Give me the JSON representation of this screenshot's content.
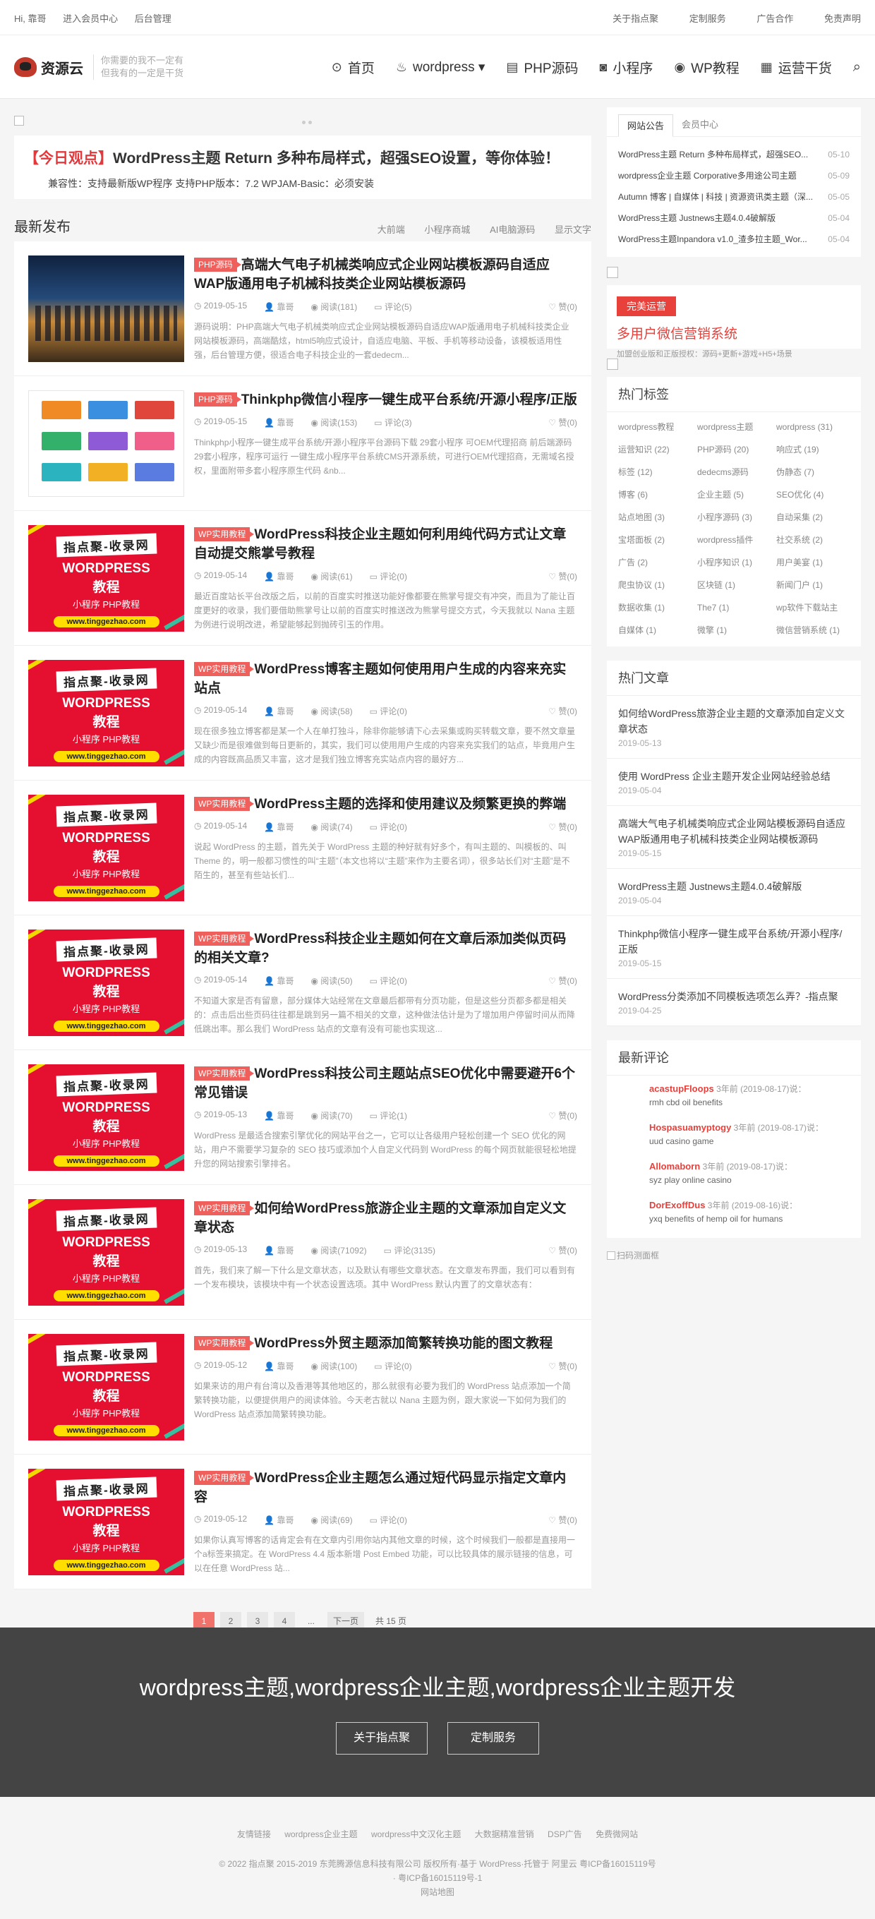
{
  "topbar": {
    "greeting": "Hi, 靠哥",
    "member": "进入会员中心",
    "admin": "后台管理",
    "links": [
      "关于指点聚",
      "定制服务",
      "广告合作",
      "免责声明"
    ]
  },
  "header": {
    "logo_text": "资源云",
    "slogan_1": "你需要的我不一定有",
    "slogan_2": "但我有的一定是干货",
    "nav": [
      {
        "icon": "home-icon",
        "glyph": "⊙",
        "label": "首页"
      },
      {
        "icon": "wordpress-icon",
        "glyph": "♨",
        "label": "wordpress ▾"
      },
      {
        "icon": "php-icon",
        "glyph": "▤",
        "label": "PHP源码"
      },
      {
        "icon": "miniapp-icon",
        "glyph": "◙",
        "label": "小程序"
      },
      {
        "icon": "wp-tutorial-icon",
        "glyph": "◉",
        "label": "WP教程"
      },
      {
        "icon": "operations-icon",
        "glyph": "▦",
        "label": "运营干货"
      }
    ]
  },
  "notice": {
    "tag": "【今日观点】",
    "title": "WordPress主题 Return 多种布局样式，超强SEO设置，等你体验！",
    "sub": "兼容性：支持最新版WP程序 支持PHP版本：7.2 WPJAM-Basic：必须安装"
  },
  "section": {
    "title": "最新发布",
    "tabs": [
      "大前端",
      "小程序商城",
      "AI电脑源码",
      "显示文字"
    ]
  },
  "thumb_text": {
    "l1": "指点聚-收录网",
    "l2": "WORDPRESS",
    "l3": "教程",
    "l4": "小程序 PHP教程",
    "l5": "www.tinggezhao.com"
  },
  "posts": [
    {
      "thumb": "city",
      "cat": "PHP源码",
      "title": "高端大气电子机械类响应式企业网站模板源码自适应WAP版通用电子机械科技类企业网站模板源码",
      "date": "2019-05-15",
      "author": "靠哥",
      "views": "阅读(181)",
      "comments": "评论(5)",
      "likes": "赞(0)",
      "excerpt": "源码说明：PHP高端大气电子机械类响应式企业网站模板源码自适应WAP版通用电子机械科技类企业网站模板源码，高端酷炫，html5响应式设计，自适应电脑、平板、手机等移动设备，该模板适用性强，后台管理方便，很适合电子科技企业的一套dedecm..."
    },
    {
      "thumb": "app",
      "cat": "PHP源码",
      "title": "Thinkphp微信小程序一键生成平台系统/开源小程序/正版",
      "date": "2019-05-15",
      "author": "靠哥",
      "views": "阅读(153)",
      "comments": "评论(3)",
      "likes": "赞(0)",
      "excerpt": "Thinkphp小程序一键生成平台系统/开源小程序平台源码下载 29套小程序 可OEM代理招商 前后端源码29套小程序，程序可运行 一键生成小程序平台系统CMS开源系统，可进行OEM代理招商，无需域名授权，里面附带多套小程序原生代码 &nb..."
    },
    {
      "thumb": "red",
      "cat": "WP实用教程",
      "title": "WordPress科技企业主题如何利用纯代码方式让文章自动提交熊掌号教程",
      "date": "2019-05-14",
      "author": "靠哥",
      "views": "阅读(61)",
      "comments": "评论(0)",
      "likes": "赞(0)",
      "excerpt": "最近百度站长平台改版之后，以前的百度实时推送功能好像都要在熊掌号提交有冲突，而且为了能让百度更好的收录，我们要借助熊掌号让以前的百度实时推送改为熊掌号提交方式，今天我就以 Nana 主题为例进行说明改进，希望能够起到抛砖引玉的作用。"
    },
    {
      "thumb": "red",
      "cat": "WP实用教程",
      "title": "WordPress博客主题如何使用用户生成的内容来充实站点",
      "date": "2019-05-14",
      "author": "靠哥",
      "views": "阅读(58)",
      "comments": "评论(0)",
      "likes": "赞(0)",
      "excerpt": "现在很多独立博客都是某一个人在单打独斗，除非你能够请下心去采集或购买转载文章，要不然文章量又缺少而是很难做到每日更新的，其实，我们可以使用用户生成的内容来充实我们的站点，毕竟用户生成的内容既高品质又丰富，这才是我们独立博客充实站点内容的最好方..."
    },
    {
      "thumb": "red",
      "cat": "WP实用教程",
      "title": "WordPress主题的选择和使用建议及频繁更换的弊端",
      "date": "2019-05-14",
      "author": "靠哥",
      "views": "阅读(74)",
      "comments": "评论(0)",
      "likes": "赞(0)",
      "excerpt": "说起 WordPress 的主题，首先关于 WordPress 主题的种好就有好多个，有叫主题的、叫模板的、叫 Theme 的，明一般都习惯性的叫“主题”（本文也将以“主题”来作为主要名词），很多站长们对“主题”是不陌生的，甚至有些站长们..."
    },
    {
      "thumb": "red",
      "cat": "WP实用教程",
      "title": "WordPress科技企业主题如何在文章后添加类似页码的相关文章?",
      "date": "2019-05-14",
      "author": "靠哥",
      "views": "阅读(50)",
      "comments": "评论(0)",
      "likes": "赞(0)",
      "excerpt": "不知道大家是否有留意，部分媒体大站经常在文章最后都带有分页功能，但是这些分页都多都是相关的：点击后出些页码往往都是跳到另一篇不相关的文章，这种做法估计是为了增加用户停留时间从而降低跳出率。那么我们 WordPress 站点的文章有没有可能也实现这..."
    },
    {
      "thumb": "red",
      "cat": "WP实用教程",
      "title": "WordPress科技公司主题站点SEO优化中需要避开6个常见错误",
      "date": "2019-05-13",
      "author": "靠哥",
      "views": "阅读(70)",
      "comments": "评论(1)",
      "likes": "赞(0)",
      "excerpt": "WordPress 是最适合搜索引擎优化的网站平台之一，它可以让各级用户轻松创建一个 SEO 优化的网站，用户不需要学习复杂的 SEO 技巧或添加个人自定义代码到 WordPress 的每个网页就能很轻松地提升您的网站搜索引擎排名。"
    },
    {
      "thumb": "red",
      "cat": "WP实用教程",
      "title": "如何给WordPress旅游企业主题的文章添加自定义文章状态",
      "date": "2019-05-13",
      "author": "靠哥",
      "views": "阅读(71092)",
      "comments": "评论(3135)",
      "likes": "赞(0)",
      "excerpt": "首先，我们来了解一下什么是文章状态，以及默认有哪些文章状态。在文章发布界面，我们可以看到有一个发布模块，该模块中有一个状态设置选项。其中 WordPress 默认内置了的文章状态有："
    },
    {
      "thumb": "red",
      "cat": "WP实用教程",
      "title": "WordPress外贸主题添加简繁转换功能的图文教程",
      "date": "2019-05-12",
      "author": "靠哥",
      "views": "阅读(100)",
      "comments": "评论(0)",
      "likes": "赞(0)",
      "excerpt": "如果来访的用户有台湾以及香港等其他地区的，那么就很有必要为我们的 WordPress 站点添加一个简繁转换功能，以便提供用户的阅读体验。今天老古就以 Nana 主题为例，跟大家说一下如何为我们的 WordPress 站点添加简繁转换功能。"
    },
    {
      "thumb": "red",
      "cat": "WP实用教程",
      "title": "WordPress企业主题怎么通过短代码显示指定文章内容",
      "date": "2019-05-12",
      "author": "靠哥",
      "views": "阅读(69)",
      "comments": "评论(0)",
      "likes": "赞(0)",
      "excerpt": "如果你认真写博客的话肯定会有在文章内引用你站内其他文章的时候，这个时候我们一般都是直接用一个a标签来搞定。在 WordPress 4.4 版本新增 Post Embed 功能，可以比较具体的展示链接的信息，可以在任意 WordPress 站..."
    }
  ],
  "pager": {
    "pages": [
      "1",
      "2",
      "3",
      "4"
    ],
    "ellipsis": "...",
    "next": "下一页",
    "total": "共 15 页"
  },
  "sidebar": {
    "tabs": [
      "网站公告",
      "会员中心"
    ],
    "notices": [
      {
        "text": "WordPress主题 Return 多种布局样式，超强SEO...",
        "date": "05-10"
      },
      {
        "text": "wordpress企业主题 Corporative多用途公司主题",
        "date": "05-09"
      },
      {
        "text": "Autumn 博客 | 自媒体 | 科技 | 资源资讯类主题（深...",
        "date": "05-05"
      },
      {
        "text": "WordPress主题 Justnews主题4.0.4破解版",
        "date": "05-04"
      },
      {
        "text": "WordPress主题Inpandora v1.0_渣多拉主题_Wor...",
        "date": "05-04"
      }
    ],
    "ad_badge": "完美运营",
    "ad_big": "多用户微信营销系统",
    "ad_small": "加盟创业版和正版授权：源码+更新+游戏+H5+场景",
    "tags_title": "热门标签",
    "tags": [
      "wordpress教程",
      "wordpress主题",
      "wordpress (31)",
      "运营知识 (22)",
      "PHP源码 (20)",
      "响应式 (19)",
      "标签 (12)",
      "dedecms源码",
      "伪静态 (7)",
      "博客 (6)",
      "企业主题 (5)",
      "SEO优化 (4)",
      "站点地图 (3)",
      "小程序源码 (3)",
      "自动采集 (2)",
      "宝塔面板 (2)",
      "wordpress插件",
      "社交系统 (2)",
      "广告 (2)",
      "小程序知识 (1)",
      "用户美宴 (1)",
      "爬虫协议 (1)",
      "区块链 (1)",
      "新闻门户 (1)",
      "数据收集 (1)",
      "The7 (1)",
      "wp软件下载站主",
      "自媒体 (1)",
      "微擎 (1)",
      "微信营销系统 (1)"
    ],
    "hot_title": "热门文章",
    "hot": [
      {
        "text": "如何给WordPress旅游企业主题的文章添加自定义文章状态",
        "date": "2019-05-13"
      },
      {
        "text": "使用 WordPress 企业主题开发企业网站经验总结",
        "date": "2019-05-04"
      },
      {
        "text": "高端大气电子机械类响应式企业网站模板源码自适应WAP版通用电子机械科技类企业网站模板源码",
        "date": "2019-05-15"
      },
      {
        "text": "WordPress主题 Justnews主题4.0.4破解版",
        "date": "2019-05-04"
      },
      {
        "text": "Thinkphp微信小程序一键生成平台系统/开源小程序/正版",
        "date": "2019-05-15"
      },
      {
        "text": "WordPress分类添加不同模板选项怎么弄？-指点聚",
        "date": "2019-04-25"
      }
    ],
    "comments_title": "最新评论",
    "comments": [
      {
        "name": "acastupFloops",
        "when": "3年前 (2019-08-17)说：",
        "text": "rmh cbd oil benefits"
      },
      {
        "name": "Hospasuamyptogy",
        "when": "3年前 (2019-08-17)说：",
        "text": "uud casino game"
      },
      {
        "name": "Allomaborn",
        "when": "3年前 (2019-08-17)说：",
        "text": "syz play online casino"
      },
      {
        "name": "DorExoffDus",
        "when": "3年前 (2019-08-16)说：",
        "text": "yxq benefits of hemp oil for humans"
      }
    ],
    "qr_alt": "扫码测面框"
  },
  "footer": {
    "slogan": "wordpress主题,wordpress企业主题,wordpress企业主题开发",
    "btn1": "关于指点聚",
    "btn2": "定制服务",
    "links": [
      "友情链接",
      "wordpress企业主题",
      "wordpress中文汉化主题",
      "大数据精准营销",
      "DSP广告",
      "免费微网站"
    ],
    "copy1": "© 2022 指点聚   2015-2019 东莞腾源信息科技有限公司 版权所有·基于 WordPress·托管于 阿里云",
    "icp1": "粤ICP备16015119号",
    "copy2": "· 粤ICP备16015119号-1",
    "sitemap": "网站地图"
  },
  "colors": {
    "accent": "#e8403b",
    "tag": "#ef5f5b",
    "footer": "#444444"
  }
}
